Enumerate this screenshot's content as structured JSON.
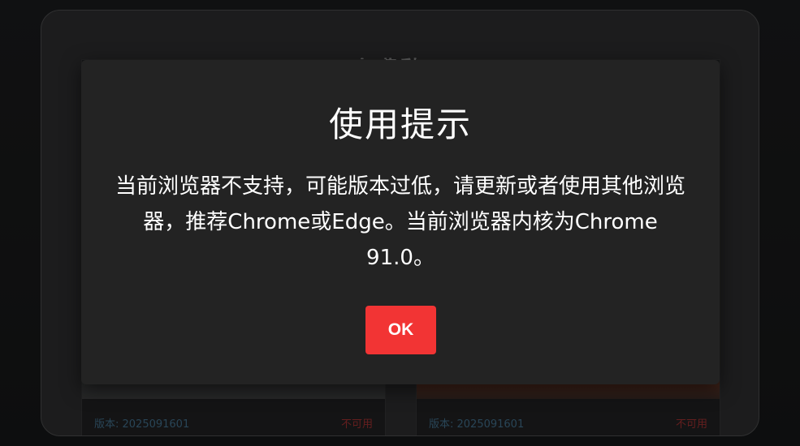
{
  "background": {
    "title": "免费黏工",
    "cards": [
      {
        "version": "版本: 2025091601",
        "status": "不可用"
      },
      {
        "version": "版本: 2025091601",
        "status": "不可用"
      }
    ]
  },
  "dialog": {
    "title": "使用提示",
    "message": "当前浏览器不支持，可能版本过低，请更新或者使用其他浏览器，推荐Chrome或Edge。当前浏览器内核为Chrome 91.0。",
    "ok_label": "OK"
  },
  "colors": {
    "accent": "#f23434",
    "dialog_bg": "#232323",
    "version_text": "#3f6a86",
    "status_text": "#9a2e2e"
  }
}
